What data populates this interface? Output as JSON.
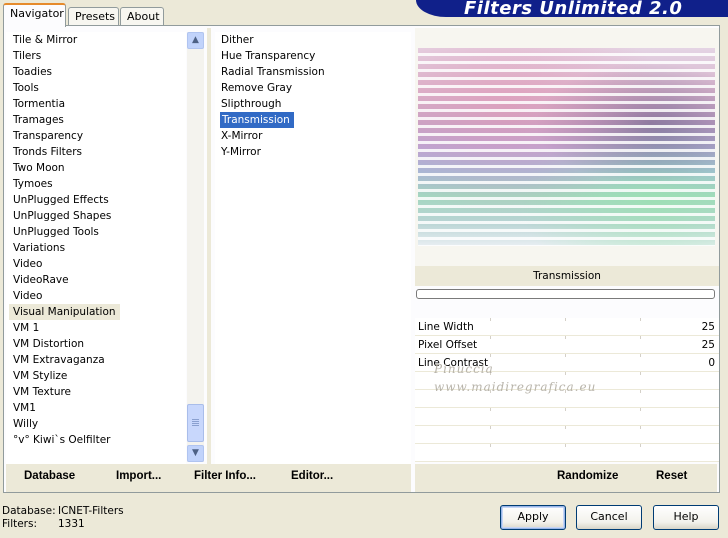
{
  "tabs": [
    {
      "label": "Navigator",
      "active": true
    },
    {
      "label": "Presets",
      "active": false
    },
    {
      "label": "About",
      "active": false
    }
  ],
  "banner_title": "Filters Unlimited 2.0",
  "category_list": {
    "items": [
      "Tile & Mirror",
      "Tilers",
      "Toadies",
      "Tools",
      "Tormentia",
      "Tramages",
      "Transparency",
      "Tronds Filters",
      "Two Moon",
      "Tymoes",
      "UnPlugged Effects",
      "UnPlugged Shapes",
      "UnPlugged Tools",
      "Variations",
      "Video",
      "VideoRave",
      "Video",
      "Visual Manipulation",
      "VM 1",
      "VM Distortion",
      "VM Extravaganza",
      "VM Stylize",
      "VM Texture",
      "VM1",
      "Willy",
      "°v° Kiwi`s Oelfilter"
    ],
    "selected": "Visual Manipulation"
  },
  "filter_list": {
    "items": [
      "Dither",
      "Hue Transparency",
      "Radial Transmission",
      "Remove Gray",
      "Slipthrough",
      "Transmission",
      "X-Mirror",
      "Y-Mirror"
    ],
    "selected": "Transmission"
  },
  "filter_title": "Transmission",
  "params": [
    {
      "label": "Line Width",
      "value": "25"
    },
    {
      "label": "Pixel Offset",
      "value": "25"
    },
    {
      "label": "Line Contrast",
      "value": "0"
    },
    {
      "label": "",
      "value": ""
    },
    {
      "label": "",
      "value": ""
    },
    {
      "label": "",
      "value": ""
    },
    {
      "label": "",
      "value": ""
    },
    {
      "label": "",
      "value": ""
    }
  ],
  "watermark": {
    "line1": "Pinuccia",
    "line2": "www.maidiregrafica.eu"
  },
  "toolbar": {
    "database": "Database",
    "import": "Import...",
    "filter_info": "Filter Info...",
    "editor": "Editor...",
    "randomize": "Randomize",
    "reset": "Reset"
  },
  "footer": {
    "database_label": "Database:",
    "database_value": "ICNET-Filters",
    "filters_label": "Filters:",
    "filters_value": "1331"
  },
  "buttons": {
    "apply": "Apply",
    "cancel": "Cancel",
    "help": "Help"
  },
  "icons": {
    "scroll_up": "arrow-up-icon",
    "scroll_down": "arrow-down-icon"
  },
  "colors": {
    "selection": "#316ac5",
    "banner": "#10208a",
    "tab_highlight": "#e68b2c"
  }
}
